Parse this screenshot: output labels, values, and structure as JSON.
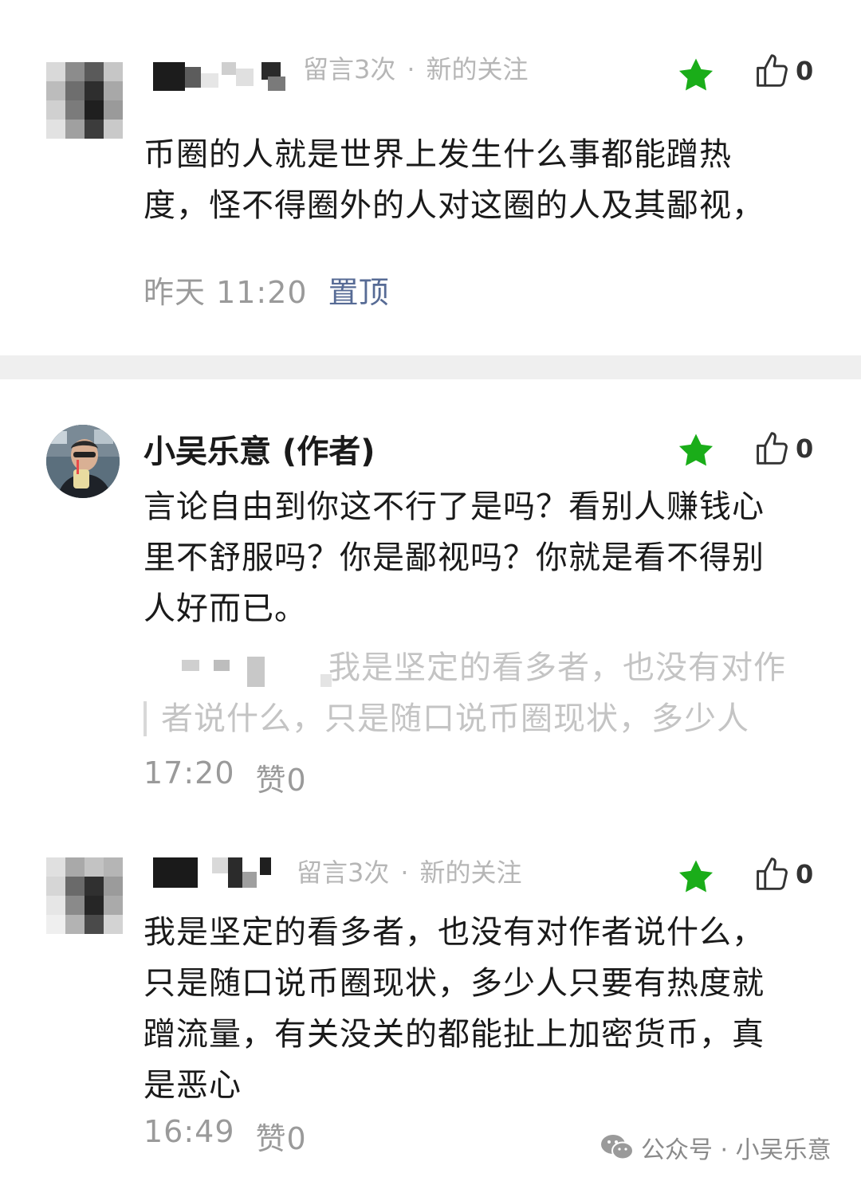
{
  "comments": [
    {
      "meta_count": "留言3次",
      "meta_sep": "·",
      "meta_status": "新的关注",
      "likes": "0",
      "content_lines": [
        "币圈的人就是世界上发生什么事都能蹭热",
        "度，怪不得圈外的人对这圈的人及其鄙视，"
      ],
      "time": "昨天 11:20",
      "pin_label": "置顶"
    },
    {
      "author_name": "小吴乐意 (作者)",
      "likes": "0",
      "content_lines": [
        "言论自由到你这不行了是吗？看别人赚钱心",
        "里不舒服吗？你是鄙视吗？你就是看不得别",
        "人好而已。"
      ],
      "quote_lines": [
        "我是坚定的看多者，也没有对作",
        "者说什么，只是随口说币圈现状，多少人"
      ],
      "time": "17:20",
      "like_text": "赞0"
    },
    {
      "meta_count": "留言3次",
      "meta_sep": "·",
      "meta_status": "新的关注",
      "likes": "0",
      "content_lines": [
        "我是坚定的看多者，也没有对作者说什么，",
        "只是随口说币圈现状，多少人只要有热度就",
        "蹭流量，有关没关的都能扯上加密货币，真",
        "是恶心"
      ],
      "time": "16:49",
      "like_text": "赞0"
    }
  ],
  "footer": {
    "brand": "公众号 · 小吴乐意"
  },
  "colors": {
    "star": "#1aad19",
    "link": "#576b95",
    "muted": "#b6b6b6",
    "separator": "#efefef"
  },
  "icons": [
    "star-icon",
    "thumb-up-icon",
    "wechat-icon"
  ]
}
